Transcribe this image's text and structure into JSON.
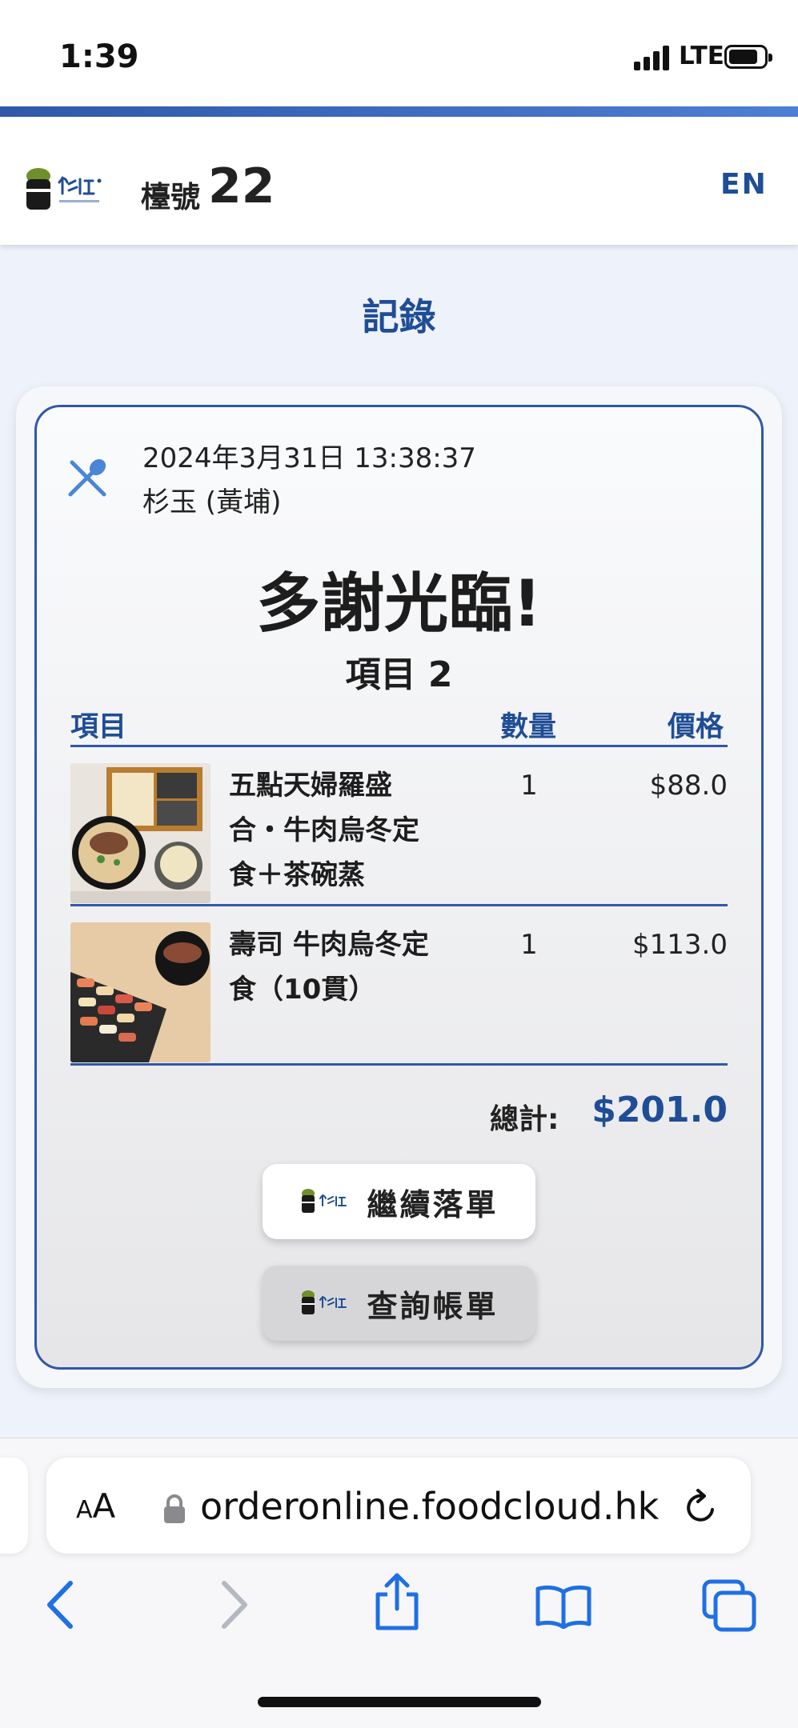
{
  "status": {
    "time": "1:39",
    "network": "LTE"
  },
  "header": {
    "table_label": "檯號",
    "table_number": "22",
    "language": "EN"
  },
  "page_title": "記錄",
  "order": {
    "datetime": "2024年3月31日 13:38:37",
    "store": "杉玉 (黃埔)",
    "thanks": "多謝光臨!",
    "item_count_label": "項目 2",
    "columns": {
      "item": "項目",
      "qty": "數量",
      "price": "價格"
    },
    "items": [
      {
        "name_lines": [
          "五點天婦羅盛",
          "合・牛肉烏冬定",
          "食＋茶碗蒸"
        ],
        "qty": "1",
        "price": "$88.0"
      },
      {
        "name_lines": [
          "壽司 牛肉烏冬定",
          "食（10貫）"
        ],
        "qty": "1",
        "price": "$113.0"
      }
    ],
    "total_label": "總計:",
    "total_value": "$201.0"
  },
  "buttons": {
    "continue_order": "繼續落單",
    "view_bill": "查詢帳單"
  },
  "browser": {
    "aa_label": "AA",
    "url": "orderonline.foodcloud.hk"
  },
  "colors": {
    "brand_blue": "#1f4d96",
    "accent_blue": "#2f58a8",
    "page_bg": "#eef2fb"
  },
  "icons": [
    "utensils-icon",
    "lock-icon",
    "reload-icon",
    "back-icon",
    "forward-icon",
    "share-icon",
    "bookmarks-icon",
    "tabs-icon"
  ]
}
